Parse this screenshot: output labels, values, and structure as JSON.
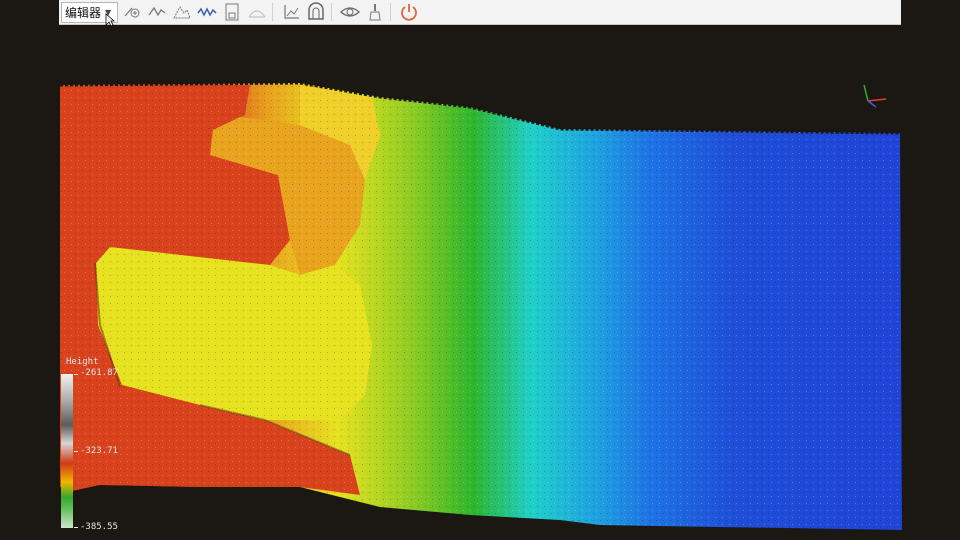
{
  "toolbar": {
    "mode_select": {
      "value": "编辑器"
    },
    "buttons": [
      {
        "name": "segment-icon"
      },
      {
        "name": "polyline-icon"
      },
      {
        "name": "profile-icon"
      },
      {
        "name": "waveform-icon"
      },
      {
        "name": "save-icon"
      },
      {
        "name": "measure-angle-icon"
      },
      {
        "name": "axis-icon"
      },
      {
        "name": "tunnel-icon"
      },
      {
        "name": "eye-icon"
      },
      {
        "name": "brush-icon"
      },
      {
        "name": "power-icon"
      }
    ],
    "colors": {
      "power": "#e0653a",
      "icons": "#555555"
    }
  },
  "legend": {
    "title": "Height",
    "max": "-261.87",
    "mid": "-323.71",
    "min": "-385.55"
  },
  "viewport": {
    "background": "#1b1712",
    "colormap": [
      "#d8431d",
      "#e9a41f",
      "#e6e21f",
      "#2fb52c",
      "#1fd8d8",
      "#1f7fe8",
      "#1f4ad8"
    ]
  }
}
